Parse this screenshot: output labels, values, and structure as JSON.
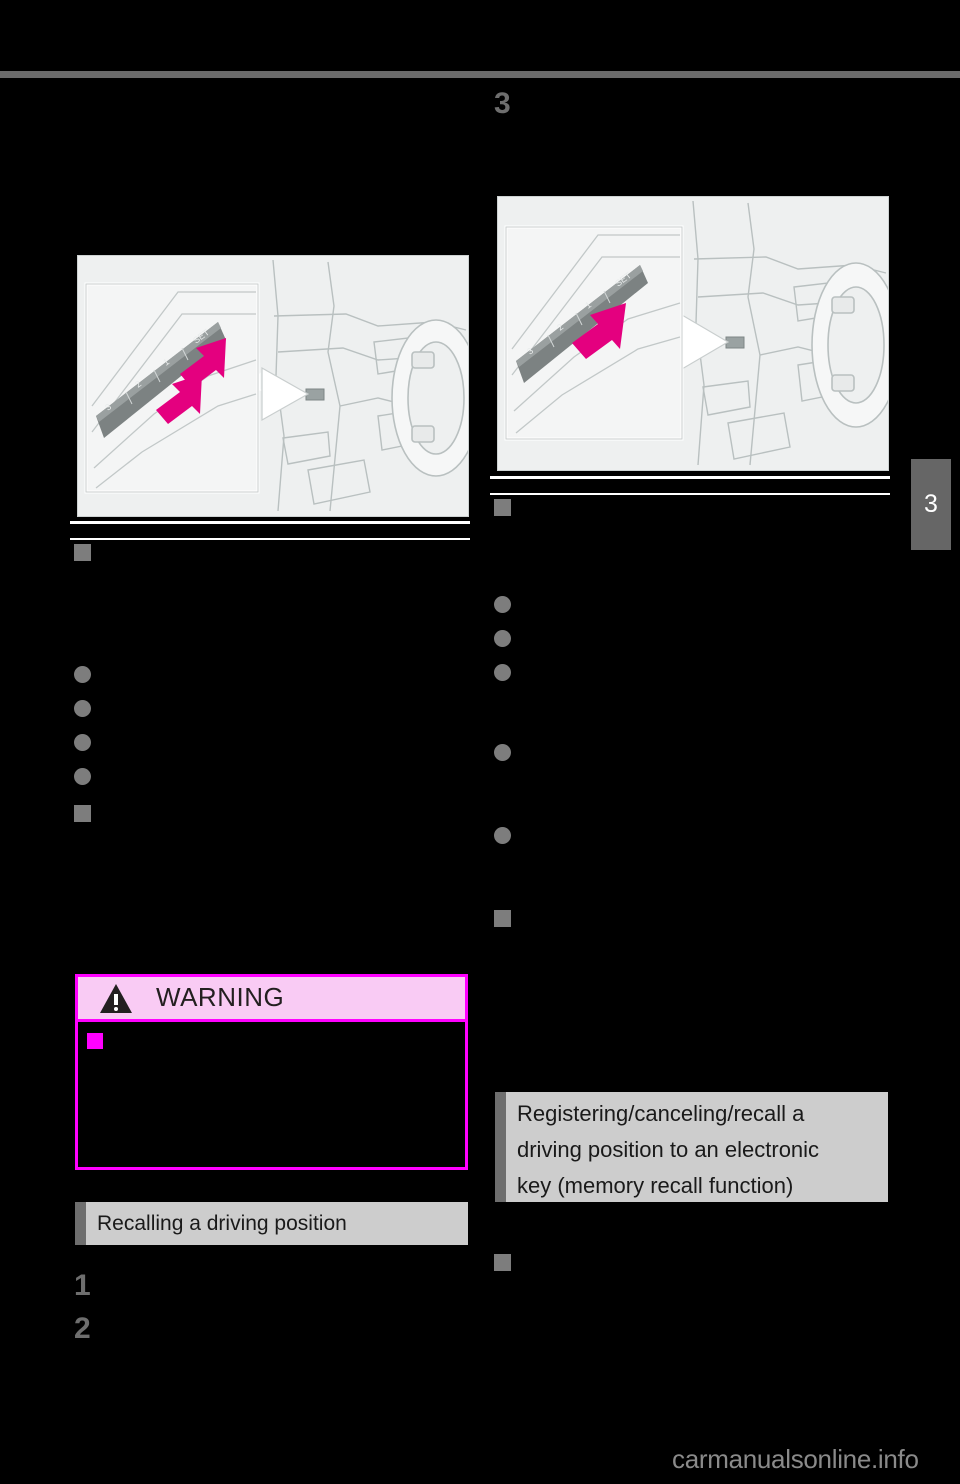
{
  "page": {
    "chapter_tab": "3",
    "watermark": "carmanualsonline.info",
    "background": "#000000",
    "accent_gray": "#6e6e6e",
    "warning_pink": "#ff00ff",
    "warning_pink_fill": "#f9cbf4",
    "section_bar_gray": "#cdcdcd"
  },
  "left_column": {
    "figure": {
      "name": "seat-memory-switch-illustration",
      "caption": "",
      "callout_labels": [
        "SET",
        "1",
        "2",
        "3"
      ],
      "arrow_color": "#e4007f",
      "arrow_count": 2
    },
    "section_rule": {
      "visible": true
    },
    "subheading_1": {
      "marker": "square",
      "text": ""
    },
    "bullets": [
      {
        "marker": "circle",
        "text": ""
      },
      {
        "marker": "circle",
        "text": ""
      },
      {
        "marker": "circle",
        "text": ""
      },
      {
        "marker": "circle",
        "text": ""
      }
    ],
    "subheading_2": {
      "marker": "square",
      "text": ""
    },
    "warning": {
      "title": "WARNING",
      "icon": "warning-triangle-icon",
      "items": [
        {
          "marker": "square",
          "text": ""
        }
      ]
    },
    "section_heading": "Recalling a driving position",
    "steps": [
      "1",
      "2"
    ]
  },
  "right_column": {
    "step_number": "3",
    "figure": {
      "name": "seat-memory-set-switch-illustration",
      "callout_labels": [
        "SET",
        "1",
        "2",
        "3"
      ],
      "arrow_color": "#e4007f",
      "arrow_count": 1
    },
    "section_rule": {
      "visible": true
    },
    "subheading_1": {
      "marker": "square",
      "text": ""
    },
    "bullets": [
      {
        "marker": "circle",
        "text": ""
      },
      {
        "marker": "circle",
        "text": ""
      },
      {
        "marker": "circle",
        "text": ""
      },
      {
        "marker": "circle",
        "text": ""
      },
      {
        "marker": "circle",
        "text": ""
      }
    ],
    "subheading_2": {
      "marker": "square",
      "text": ""
    },
    "section_heading": "Registering/canceling/recall a driving position to an electronic key (memory recall function)",
    "section_heading_lines": [
      "Registering/canceling/recall a",
      "driving position to an electronic",
      "key (memory recall function)"
    ],
    "subheading_3": {
      "marker": "square",
      "text": ""
    }
  }
}
